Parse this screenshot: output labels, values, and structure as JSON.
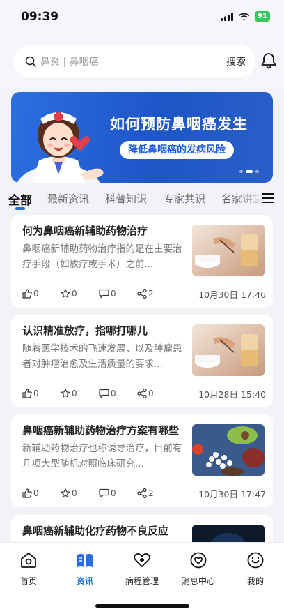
{
  "status_bar": {
    "time": "09:39",
    "battery": "91"
  },
  "search": {
    "placeholder": "鼻炎 | 鼻咽癌",
    "button_label": "搜索"
  },
  "banner": {
    "title": "如何预防鼻咽癌发生",
    "subtitle": "降低鼻咽癌的发病风险"
  },
  "tabs": [
    {
      "label": "全部",
      "active": true
    },
    {
      "label": "最新资讯"
    },
    {
      "label": "科普知识"
    },
    {
      "label": "专家共识"
    },
    {
      "label": "名家讲堂"
    }
  ],
  "articles": [
    {
      "title": "何为鼻咽癌新辅助药物治疗",
      "desc": "鼻咽癌新辅助药物治疗指的是在主要治疗手段（如放疗或手术）之前...",
      "likes": "0",
      "stars": "0",
      "comments": "0",
      "shares": "2",
      "date": "10月30日 17:46",
      "thumb": "medicine-cup"
    },
    {
      "title": "认识精准放疗，指哪打哪儿",
      "desc": "随着医学技术的飞速发展，以及肿瘤患者对肿瘤治愈及生活质量的要求...",
      "likes": "0",
      "stars": "0",
      "comments": "0",
      "shares": "0",
      "date": "10月28日 15:40",
      "thumb": "medicine-cup"
    },
    {
      "title": "鼻咽癌新辅助药物治疗方案有哪些",
      "desc": "新辅助药物治疗也称诱导治疗，目前有几项大型随机对照临床研究...",
      "likes": "0",
      "stars": "0",
      "comments": "0",
      "shares": "2",
      "date": "10月30日 17:47",
      "thumb": "food-pills"
    },
    {
      "title": "鼻咽癌新辅助化疗药物不良反应",
      "desc": "",
      "likes": "",
      "stars": "",
      "comments": "",
      "shares": "",
      "date": "",
      "thumb": "dark-scan"
    }
  ],
  "bottom_nav": [
    {
      "label": "首页",
      "icon": "home-icon"
    },
    {
      "label": "资讯",
      "icon": "book-icon",
      "active": true
    },
    {
      "label": "病程管理",
      "icon": "heart-plus-icon"
    },
    {
      "label": "消息中心",
      "icon": "heart-chat-icon"
    },
    {
      "label": "我的",
      "icon": "smile-icon"
    }
  ],
  "colors": {
    "accent": "#2a6de0",
    "banner": "#1e56c8"
  }
}
